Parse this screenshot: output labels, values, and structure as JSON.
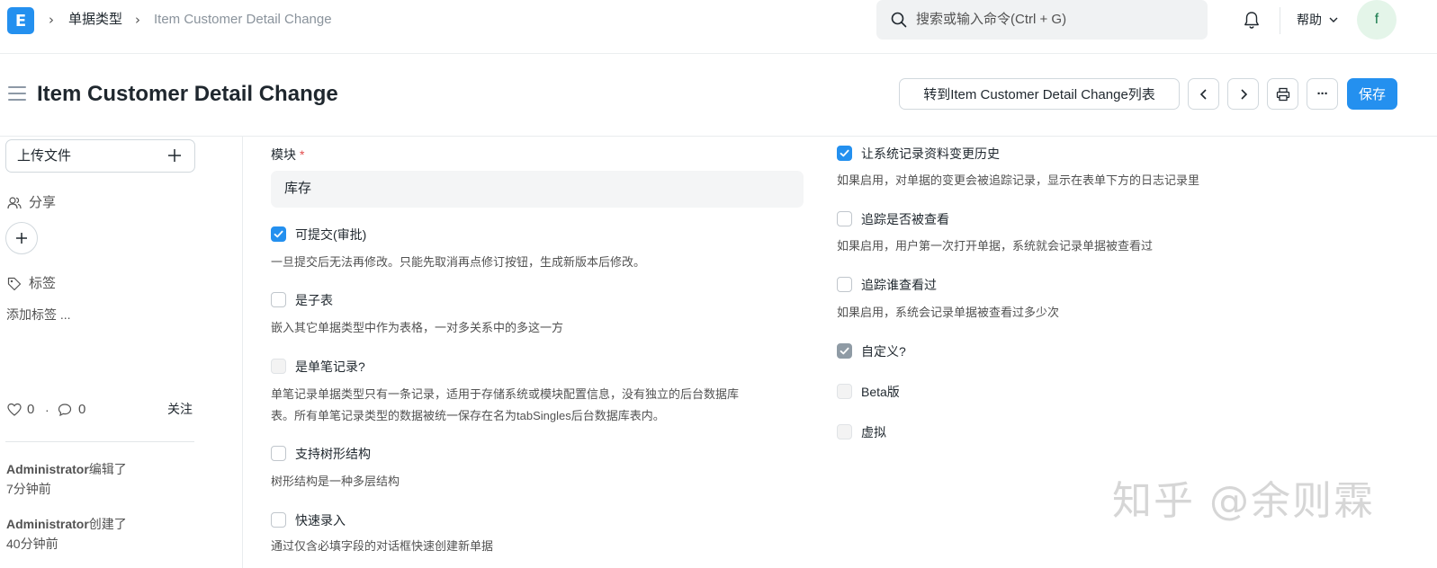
{
  "navbar": {
    "logo_letter": "E",
    "breadcrumbs": [
      "单据类型",
      "Item Customer Detail Change"
    ],
    "search_placeholder": "搜索或输入命令(Ctrl + G)",
    "help_label": "帮助",
    "avatar_letter": "f"
  },
  "page": {
    "title": "Item Customer Detail Change",
    "list_button_label": "转到Item Customer Detail Change列表",
    "save_label": "保存",
    "more_label": "···"
  },
  "sidebar": {
    "upload_label": "上传文件",
    "share_label": "分享",
    "tags_label": "标签",
    "add_tag_label": "添加标签 ...",
    "likes_count": "0",
    "comments_count": "0",
    "dot_separator": "·",
    "follow_label": "关注",
    "activity": [
      {
        "user": "Administrator",
        "action": "编辑了",
        "time": "7分钟前"
      },
      {
        "user": "Administrator",
        "action": "创建了",
        "time": "40分钟前"
      }
    ]
  },
  "form": {
    "module": {
      "label": "模块",
      "required_mark": "*",
      "value": "库存"
    },
    "left_fields": [
      {
        "label": "可提交(审批)",
        "checked": true,
        "disabled": false,
        "description": "一旦提交后无法再修改。只能先取消再点修订按钮，生成新版本后修改。"
      },
      {
        "label": "是子表",
        "checked": false,
        "disabled": false,
        "description": "嵌入其它单据类型中作为表格，一对多关系中的多这一方"
      },
      {
        "label": "是单笔记录?",
        "checked": false,
        "disabled": true,
        "description_line1": "单笔记录单据类型只有一条记录，适用于存储系统或模块配置信息，没有独立的后台数据库",
        "description_line2": "表。所有单笔记录类型的数据被统一保存在名为tabSingles后台数据库表内。"
      },
      {
        "label": "支持树形结构",
        "checked": false,
        "disabled": false,
        "description": "树形结构是一种多层结构"
      },
      {
        "label": "快速录入",
        "checked": false,
        "disabled": false,
        "description": "通过仅含必填字段的对话框快速创建新单据"
      }
    ],
    "right_fields": [
      {
        "label": "让系统记录资料变更历史",
        "checked": true,
        "disabled": false,
        "description": "如果启用，对单据的变更会被追踪记录，显示在表单下方的日志记录里"
      },
      {
        "label": "追踪是否被查看",
        "checked": false,
        "disabled": false,
        "description": "如果启用，用户第一次打开单据，系统就会记录单据被查看过"
      },
      {
        "label": "追踪谁查看过",
        "checked": false,
        "disabled": false,
        "description": "如果启用，系统会记录单据被查看过多少次"
      },
      {
        "label": "自定义?",
        "checked": true,
        "disabled": true,
        "description": ""
      },
      {
        "label": "Beta版",
        "checked": false,
        "disabled": true,
        "description": ""
      },
      {
        "label": "虚拟",
        "checked": false,
        "disabled": true,
        "description": ""
      }
    ]
  },
  "watermark": "知乎 @余则霖",
  "colors": {
    "primary": "#2490ef",
    "text": "#1f272e",
    "muted": "#525252",
    "border": "#d1d8dd"
  }
}
